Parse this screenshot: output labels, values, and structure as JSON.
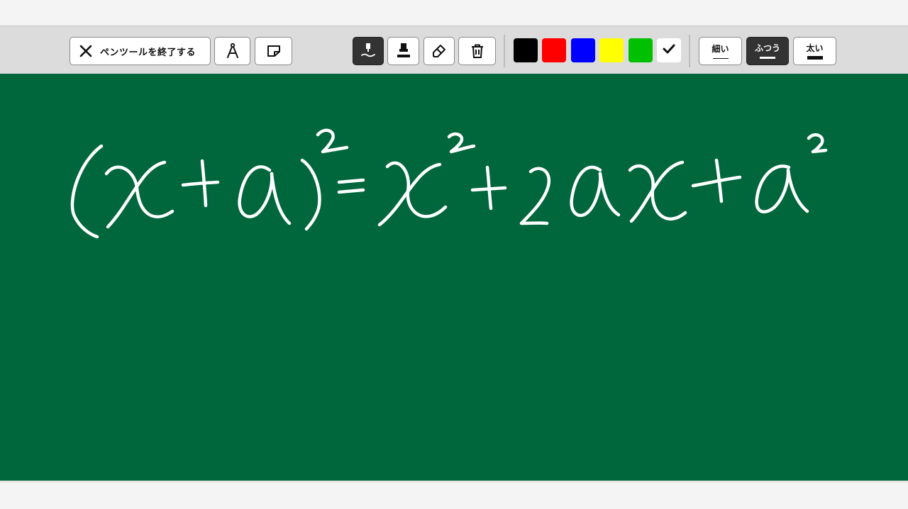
{
  "toolbar": {
    "exit_label": "ペンツールを終了する",
    "line_widths": {
      "thin": "細い",
      "normal": "ふつう",
      "thick": "太い",
      "selected": "normal"
    }
  },
  "palette": {
    "colors": [
      "#000000",
      "#ff0000",
      "#0000ff",
      "#ffff00",
      "#00c000",
      "#ffffff"
    ],
    "selected_color": "#ffffff"
  },
  "board": {
    "background": "#00663c",
    "stroke_color": "#ffffff"
  },
  "icons": [
    "close-icon",
    "compass-icon",
    "sticky-note-icon",
    "pen-icon",
    "marker-icon",
    "eraser-icon",
    "trash-icon",
    "check-icon"
  ]
}
